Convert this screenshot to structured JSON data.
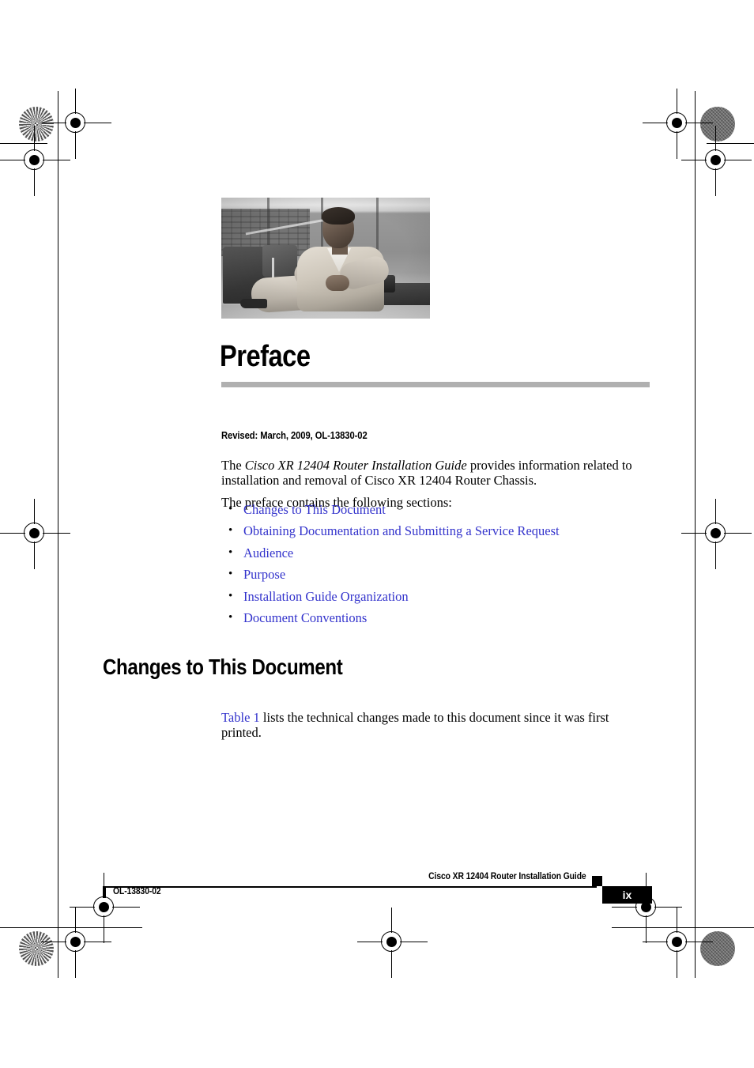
{
  "page": {
    "chapter_title": "Preface",
    "revised_line": "Revised: March, 2009, OL-13830-02",
    "accent_rule_color": "#b0b0b0",
    "link_color": "#3333cc"
  },
  "intro": {
    "lead_the": "The ",
    "book_title_italic": "Cisco XR 12404 Router Installation Guide",
    "lead_rest": " provides information related to installation and removal of Cisco XR 12404 Router Chassis.",
    "sections_sentence": "The preface contains the following sections:"
  },
  "bullets": [
    {
      "marker": "•",
      "label": "Changes to This Document"
    },
    {
      "marker": "•",
      "label": "Obtaining Documentation and Submitting a Service Request"
    },
    {
      "marker": "•",
      "label": "Audience"
    },
    {
      "marker": "•",
      "label": "Purpose"
    },
    {
      "marker": "•",
      "label": "Installation Guide Organization"
    },
    {
      "marker": "•",
      "label": "Document Conventions"
    }
  ],
  "section": {
    "heading": "Changes to This Document",
    "table_link": "Table 1",
    "table_sentence": " lists the technical changes made to this document since it was first printed."
  },
  "footer": {
    "guide_title": "Cisco XR 12404 Router Installation Guide",
    "doc_id": "OL-13830-02",
    "page_number": "ix"
  },
  "figure": {
    "caption": "grayscale photograph of a seated man in a lounge area"
  }
}
